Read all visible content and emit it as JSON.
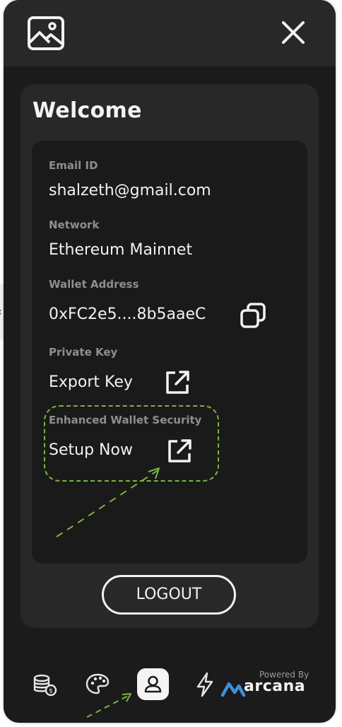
{
  "header": {
    "logo_icon": "image-icon",
    "close_icon": "close-icon"
  },
  "card": {
    "title": "Welcome",
    "fields": [
      {
        "label": "Email ID",
        "value": "shalzeth@gmail.com"
      },
      {
        "label": "Network",
        "value": "Ethereum Mainnet"
      },
      {
        "label": "Wallet Address",
        "value": "0xFC2e5....8b5aaeC",
        "icon": "copy-icon"
      },
      {
        "label": "Private Key",
        "value": "Export Key",
        "icon": "external-link-icon"
      },
      {
        "label": "Enhanced Wallet Security",
        "value": "Setup Now",
        "icon": "external-link-icon"
      }
    ],
    "logout_label": "LOGOUT"
  },
  "nav": {
    "items": [
      {
        "icon": "coins-icon"
      },
      {
        "icon": "palette-icon"
      },
      {
        "icon": "user-icon",
        "active": true
      },
      {
        "icon": "bolt-icon"
      }
    ],
    "powered_by": "Powered By",
    "brand": "arcana"
  },
  "colors": {
    "panel_bg": "#1b1b1b",
    "header_bg": "#282828",
    "card_bg": "#282828",
    "info_bg": "#1a1a1a",
    "highlight": "#7cb342",
    "brand_blue": "#3d8fe0"
  }
}
